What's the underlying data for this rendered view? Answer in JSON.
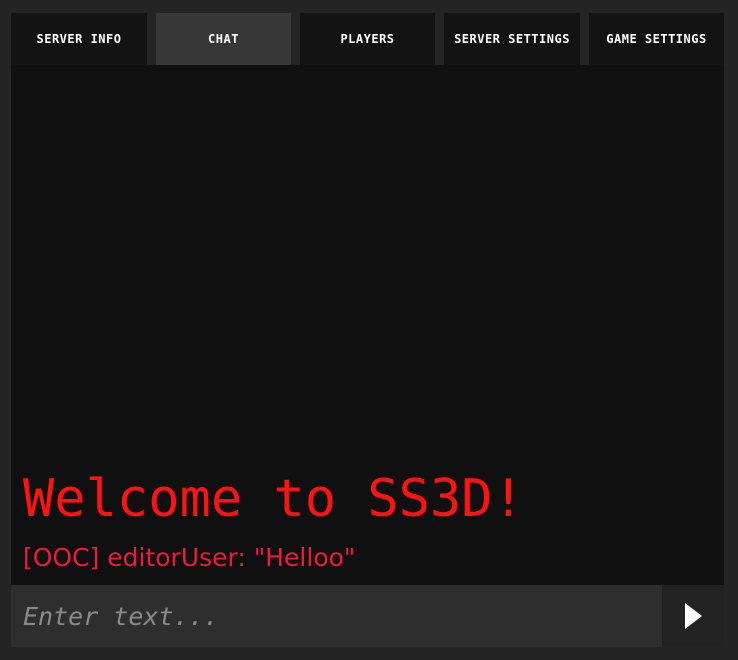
{
  "tabs": [
    {
      "label": "SERVER INFO",
      "active": false
    },
    {
      "label": "CHAT",
      "active": true
    },
    {
      "label": "PLAYERS",
      "active": false
    },
    {
      "label": "SERVER SETTINGS",
      "active": false
    },
    {
      "label": "GAME SETTINGS",
      "active": false
    }
  ],
  "chat": {
    "welcome_text": "Welcome to SS3D!",
    "messages": [
      {
        "text": "[OOC] editorUser: \"Helloo\"",
        "color": "#ee1b3a"
      }
    ]
  },
  "input": {
    "placeholder": "Enter text...",
    "value": ""
  },
  "send": {
    "icon": "play-triangle-icon"
  },
  "colors": {
    "welcome": "#ff1212",
    "message": "#ee1b3a",
    "active_tab": "#373737",
    "tab": "#131313"
  }
}
